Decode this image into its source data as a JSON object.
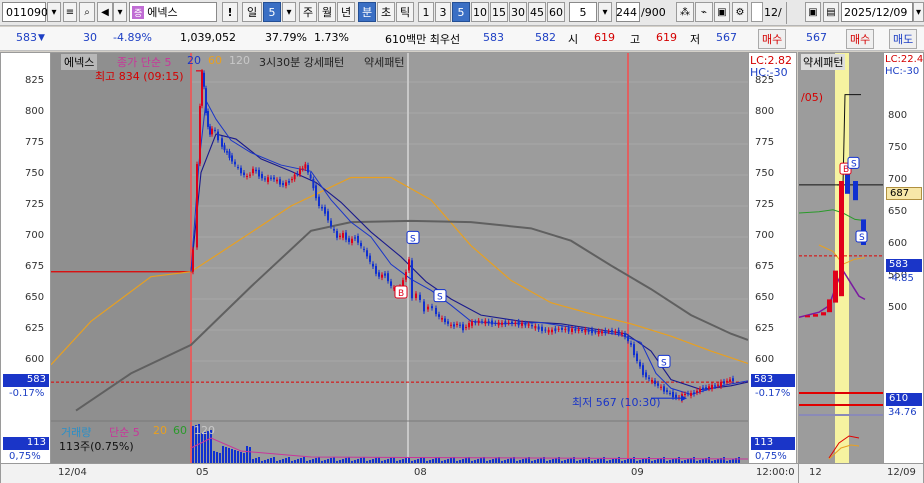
{
  "toolbar": {
    "code": "011090",
    "stock_name": "에넥스",
    "period_day": "일",
    "period_count": "5",
    "week": "주",
    "month": "월",
    "year": "년",
    "minute": "분",
    "second": "초",
    "tick": "틱",
    "intervals": [
      "1",
      "3",
      "5",
      "10",
      "15",
      "30",
      "45",
      "60"
    ],
    "interval_value": "5",
    "count_value": "244",
    "count_total": "/900",
    "right_checkbox_label": "12/",
    "right_date": "2025/12/09"
  },
  "quote": {
    "price": "583",
    "change": "30",
    "change_rate": "-4.89%",
    "volume": "1,039,052",
    "volume_rate": "37.79%",
    "turnover_rate": "1.73%",
    "amount_label": "610백만 최우선",
    "best_ask": "583",
    "best_bid": "582",
    "open_label": "시",
    "open": "619",
    "high_label": "고",
    "high": "619",
    "low_label": "저",
    "low": "567",
    "buy_button": "매수",
    "right_price": "567",
    "right_buy": "매수",
    "right_sell": "매도"
  },
  "price_chart": {
    "legend_name": "에넥스",
    "legend_close": "종가 단순 5",
    "legend_ma": [
      "20",
      "60",
      "120"
    ],
    "legend_pattern1": "3시30분 강세패턴",
    "legend_pattern2": "약세패턴",
    "high_annotation": "최고 834 (09:15)",
    "low_annotation": "최저 567 (10:30)",
    "lc_label": "LC:2.82",
    "hc_label": "HC:-30",
    "yticks": [
      "825",
      "800",
      "775",
      "750",
      "725",
      "700",
      "675",
      "650",
      "625",
      "600"
    ],
    "current_price": "583",
    "current_rate": "-0.17%",
    "colors": {
      "up": "#e0001a",
      "down": "#1030d0",
      "ma5": "#1a1a8c",
      "ma20": "#1a1a8c",
      "ma60": "#e8a020",
      "ma120": "#606060"
    }
  },
  "volume_chart": {
    "legend_name": "거래량",
    "legend_ma": "단순 5",
    "legend_periods": [
      "20",
      "60",
      "120"
    ],
    "value_text": "113주(0.75%)",
    "current": "113",
    "current_rate": "0,75%"
  },
  "x_axis": {
    "labels": [
      "12/04",
      "05",
      "08",
      "09"
    ],
    "time": "12:00:0"
  },
  "right_chart": {
    "title": "약세패턴",
    "label_05": "/05)",
    "lc_label": "LC:22.4",
    "hc_label": "HC:-30",
    "yticks": [
      "800",
      "750",
      "700",
      "650",
      "600",
      "550",
      "500"
    ],
    "price_box": "687",
    "current_price": "583",
    "current_rate": "-4.85",
    "volume_box": "610",
    "volume_rate": "34.76",
    "x_labels": [
      "12",
      "12/09"
    ]
  }
}
